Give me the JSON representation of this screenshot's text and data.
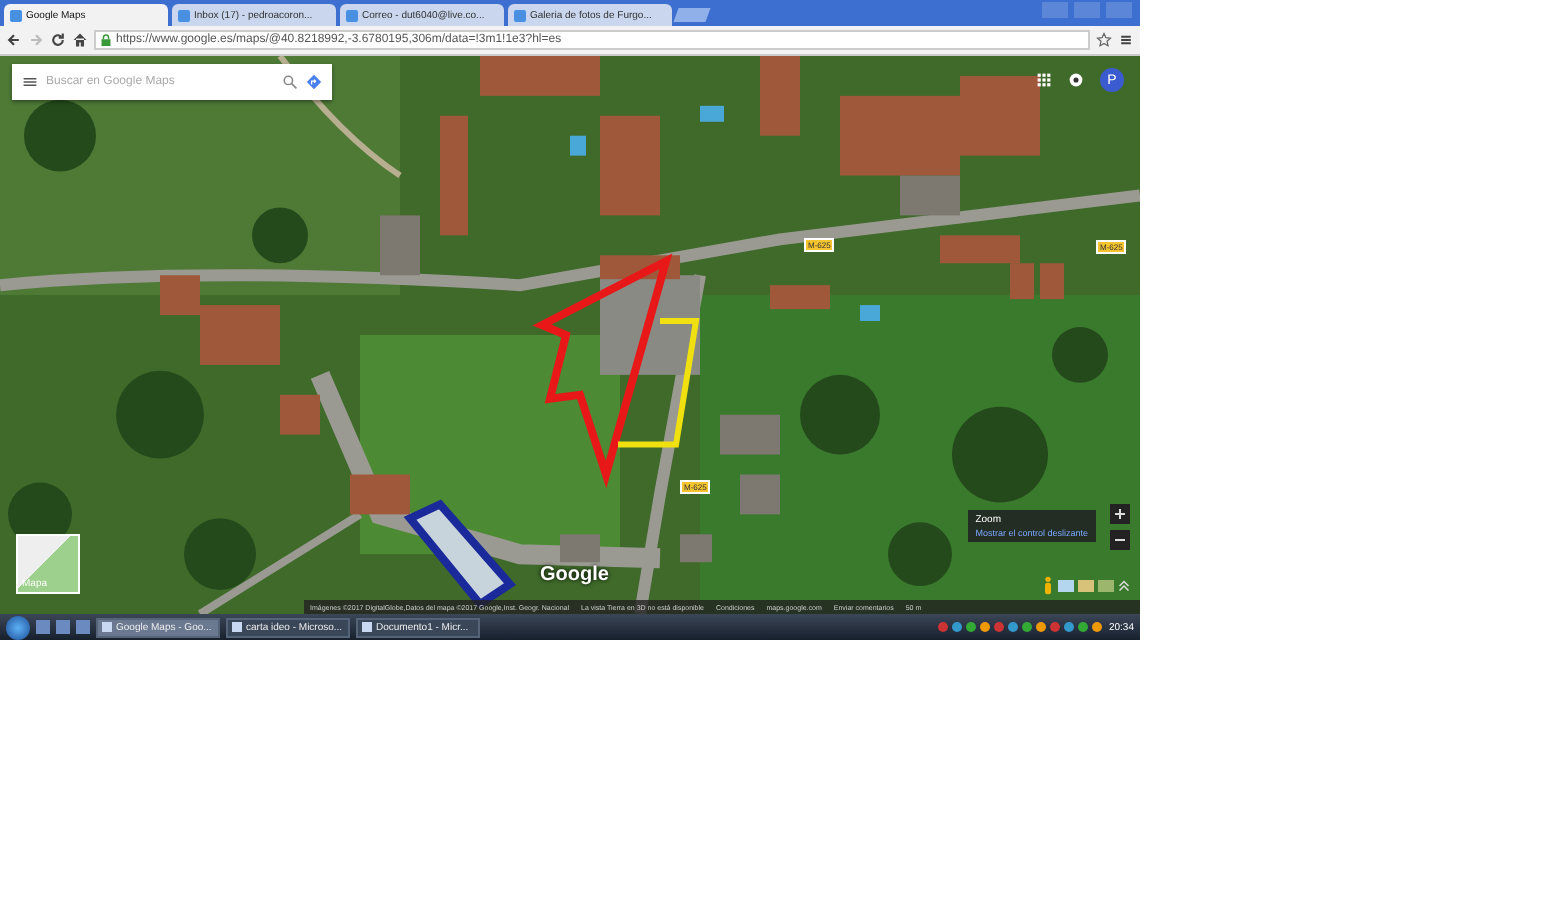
{
  "tabs": [
    {
      "title": "Google Maps",
      "selected": true
    },
    {
      "title": "Inbox (17) - pedroacoron...",
      "selected": false
    },
    {
      "title": "Correo - dut6040@live.co...",
      "selected": false
    },
    {
      "title": "Galeria de fotos de Furgo...",
      "selected": false
    }
  ],
  "address": "https://www.google.es/maps/@40.8218992,-3.6780195,306m/data=!3m1!1e3?hl=es",
  "map": {
    "search_placeholder": "Buscar en Google Maps",
    "avatar": "P",
    "road_labels": [
      "M-625",
      "M-625",
      "M-625"
    ],
    "layer_label": "Mapa",
    "logo": "Google",
    "zoom_tip": {
      "title": "Zoom",
      "link": "Mostrar el control deslizante"
    },
    "attribution": [
      "Imágenes ©2017 DigitalGlobe,Datos del mapa ©2017 Google,Inst. Geogr. Nacional",
      "La vista Tierra en 3D no está disponible",
      "Condiciones",
      "maps.google.com",
      "Enviar comentarios",
      "50 m"
    ]
  },
  "taskbar": {
    "items": [
      {
        "label": "Google Maps - Goo...",
        "selected": true
      },
      {
        "label": "carta ideo - Microso...",
        "selected": false
      },
      {
        "label": "Documento1 - Micr...",
        "selected": false
      }
    ],
    "clock": "20:34"
  }
}
